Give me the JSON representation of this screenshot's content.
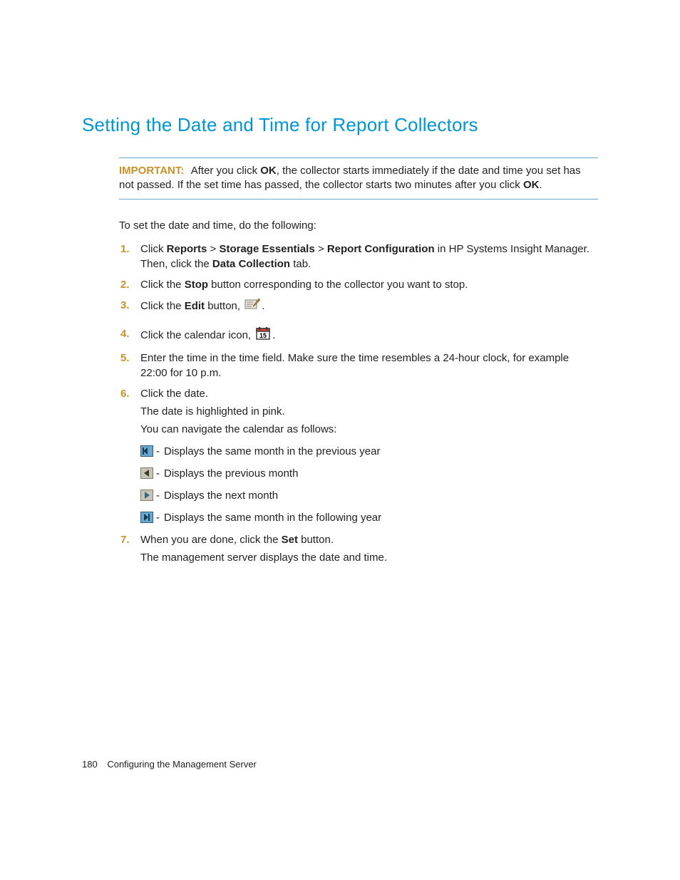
{
  "title": "Setting the Date and Time for Report Collectors",
  "important": {
    "label": "IMPORTANT:",
    "text_before": "After you click ",
    "ok1": "OK",
    "text_mid": ", the collector starts immediately if the date and time you set has not passed. If the set time has passed, the collector starts two minutes after you click ",
    "ok2": "OK",
    "text_after": "."
  },
  "intro": "To set the date and time, do the following:",
  "steps": {
    "s1": {
      "pre": "Click ",
      "b1": "Reports",
      "gt1": " > ",
      "b2": "Storage Essentials",
      "gt2": " > ",
      "b3": "Report Configuration",
      "mid": " in HP Systems Insight Manager. Then, click the ",
      "b4": "Data Collection",
      "post": " tab."
    },
    "s2": {
      "pre": "Click the ",
      "b1": "Stop",
      "post": " button corresponding to the collector you want to stop."
    },
    "s3": {
      "pre": "Click the ",
      "b1": "Edit",
      "post": " button, ",
      "end": "."
    },
    "s4": {
      "pre": "Click the calendar icon, ",
      "end": "."
    },
    "s5": "Enter the time in the time field. Make sure the time resembles a 24-hour clock, for example 22:00 for 10 p.m.",
    "s6": {
      "line1": "Click the date.",
      "line2": "The date is highlighted in pink.",
      "line3": "You can navigate the calendar as follows:",
      "nav": [
        "Displays the same month in the previous year",
        "Displays the previous month",
        "Displays the next month",
        "Displays the same month in the following year"
      ]
    },
    "s7": {
      "pre": "When you are done, click the ",
      "b1": "Set",
      "post": " button.",
      "line2": "The management server displays the date and time."
    }
  },
  "footer": {
    "page": "180",
    "section": "Configuring the Management Server"
  },
  "dash": "-"
}
